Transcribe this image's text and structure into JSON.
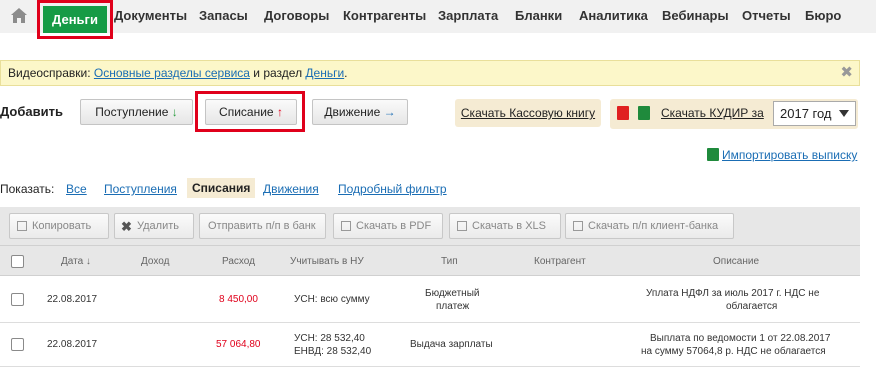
{
  "nav": {
    "home_icon": "home-icon",
    "active": "Деньги",
    "items": [
      "Документы",
      "Запасы",
      "Договоры",
      "Контрагенты",
      "Зарплата",
      "Бланки",
      "Аналитика",
      "Вебинары",
      "Отчеты",
      "Бюро"
    ]
  },
  "info": {
    "prefix": "Видеосправки: ",
    "link1": "Основные разделы сервиса",
    "middle": " и раздел ",
    "link2": "Деньги",
    "suffix": ".",
    "close": "✖"
  },
  "add": {
    "label": "Добавить",
    "income": "Поступление",
    "income_arrow": "↓",
    "expense": "Списание",
    "expense_arrow": "↑",
    "movement": "Движение",
    "movement_arrow": "→",
    "cash_book": "Скачать Кассовую книгу",
    "kudir": "Скачать КУДИР за",
    "year": "2017 год"
  },
  "import": "Импортировать выписку",
  "filter": {
    "label": "Показать:",
    "all": "Все",
    "income": "Поступления",
    "expense": "Списания",
    "movements": "Движения",
    "detailed": "Подробный фильтр"
  },
  "toolbar": {
    "copy": "Копировать",
    "delete": "Удалить",
    "send": "Отправить п/п в банк",
    "pdf": "Скачать в PDF",
    "xls": "Скачать в XLS",
    "client_bank": "Скачать п/п клиент-банка"
  },
  "table": {
    "headers": [
      "Дата ↓",
      "Доход",
      "Расход",
      "Учитывать в НУ",
      "Тип",
      "Контрагент",
      "Описание"
    ],
    "rows": [
      {
        "date": "22.08.2017",
        "expense": "8 450,00",
        "tax_line1": "УСН: всю сумму",
        "tax_line2": "",
        "type_line1": "Бюджетный",
        "type_line2": "платеж",
        "desc_line1": "Уплата НДФЛ за июль 2017 г. НДС не",
        "desc_line2": "облагается"
      },
      {
        "date": "22.08.2017",
        "expense": "57 064,80",
        "tax_line1": "УСН: 28 532,40",
        "tax_line2": "ЕНВД: 28 532,40",
        "type_line1": "Выдача зарплаты",
        "type_line2": "",
        "desc_line1": "Выплата по ведомости 1 от 22.08.2017",
        "desc_line2": "на сумму 57064,8 р. НДС не облагается"
      }
    ]
  },
  "colors": {
    "active_nav": "#169b46",
    "highlight": "#e0001b",
    "link": "#1a6db4",
    "info_bg": "#fcf7c9",
    "accent_box": "#f5ebd3"
  }
}
